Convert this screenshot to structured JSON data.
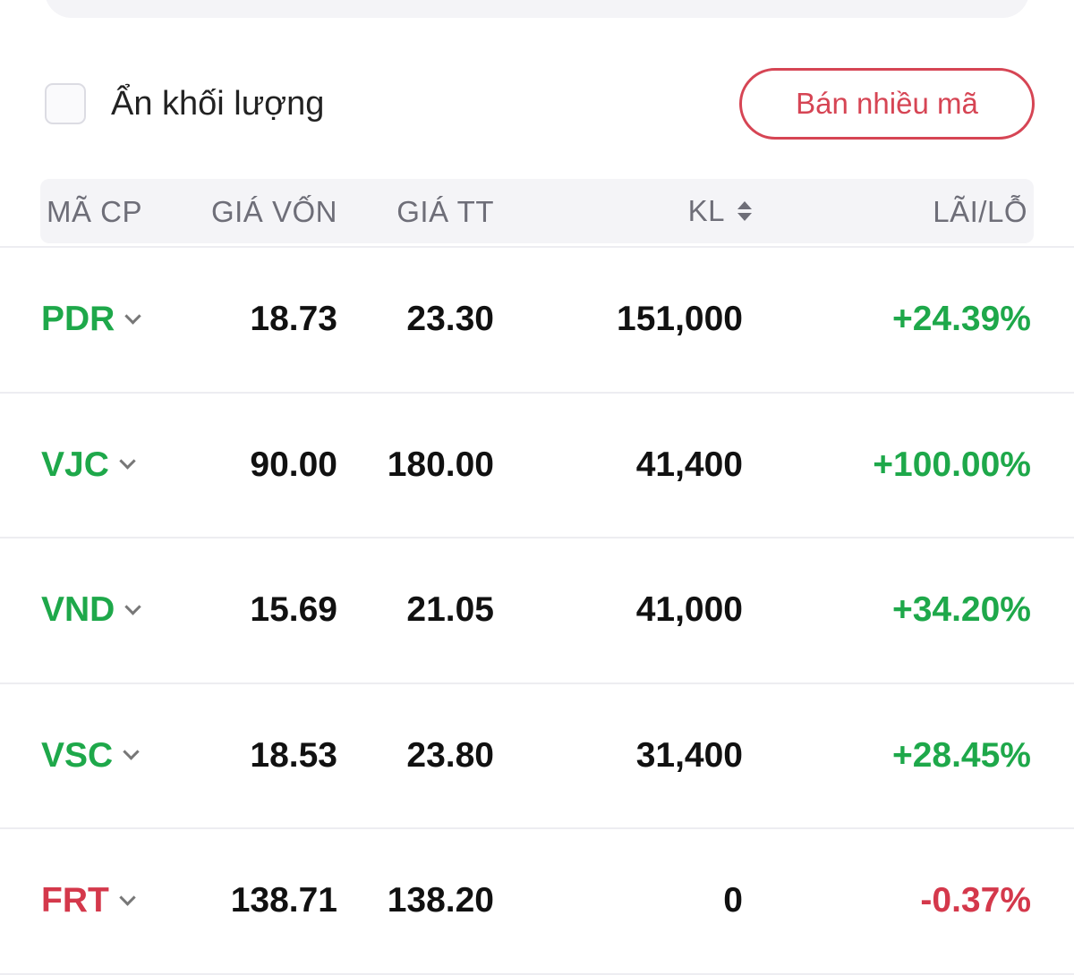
{
  "filters": {
    "hide_volume_label": "Ẩn khối lượng",
    "hide_volume_checked": false
  },
  "actions": {
    "sell_multiple_label": "Bán nhiều mã"
  },
  "table": {
    "headers": {
      "code": "MÃ CP",
      "cost_price": "GIÁ VỐN",
      "market_price": "GIÁ TT",
      "volume": "KL",
      "profit_loss": "LÃI/LỖ"
    },
    "rows": [
      {
        "code": "PDR",
        "cost_price": "18.73",
        "market_price": "23.30",
        "volume": "151,000",
        "profit_loss": "+24.39%",
        "trend": "up"
      },
      {
        "code": "VJC",
        "cost_price": "90.00",
        "market_price": "180.00",
        "volume": "41,400",
        "profit_loss": "+100.00%",
        "trend": "up"
      },
      {
        "code": "VND",
        "cost_price": "15.69",
        "market_price": "21.05",
        "volume": "41,000",
        "profit_loss": "+34.20%",
        "trend": "up"
      },
      {
        "code": "VSC",
        "cost_price": "18.53",
        "market_price": "23.80",
        "volume": "31,400",
        "profit_loss": "+28.45%",
        "trend": "up"
      },
      {
        "code": "FRT",
        "cost_price": "138.71",
        "market_price": "138.20",
        "volume": "0",
        "profit_loss": "-0.37%",
        "trend": "down"
      }
    ]
  },
  "colors": {
    "gain": "#1ea84a",
    "loss": "#d4384b",
    "accent": "#d64554"
  }
}
